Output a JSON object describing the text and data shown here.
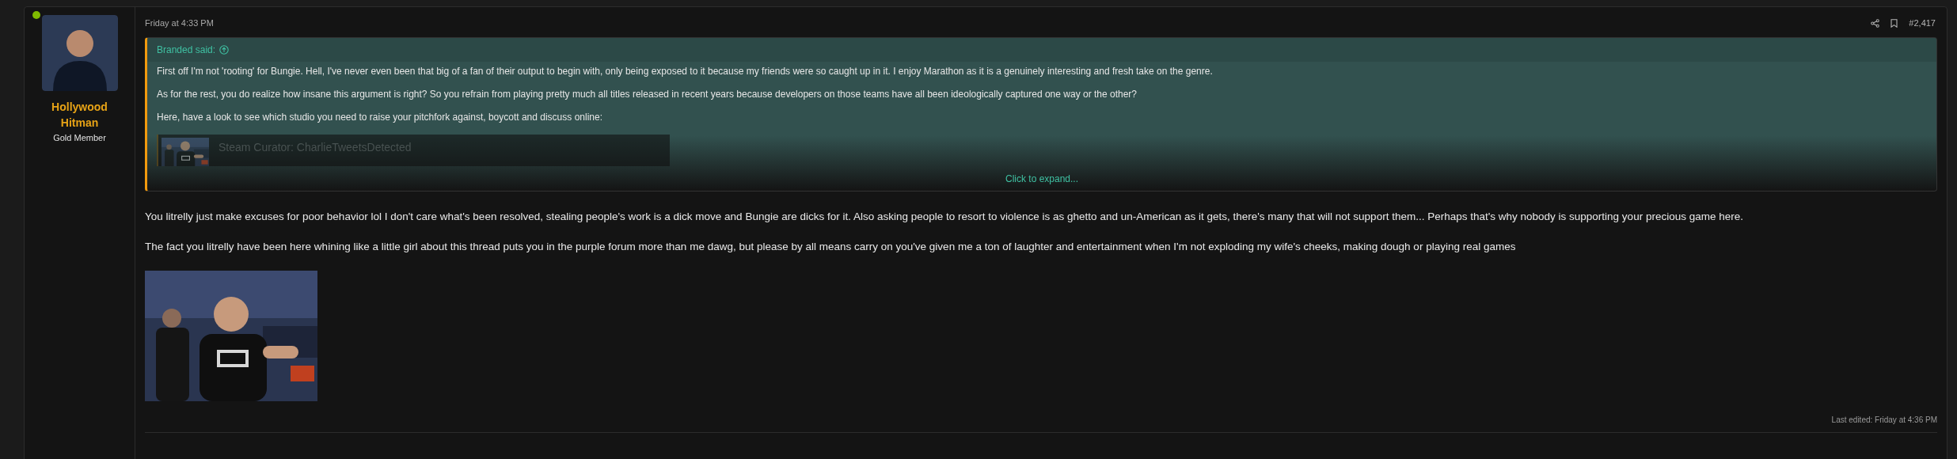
{
  "post": {
    "author": {
      "name": "Hollywood Hitman",
      "title": "Gold Member",
      "online": true
    },
    "date": "Friday at 4:33 PM",
    "post_number": "#2,417",
    "quote": {
      "attribution": "Branded said:",
      "paragraphs": [
        "First off I'm not 'rooting' for Bungie. Hell, I've never even been that big of a fan of their output to begin with, only being exposed to it because my friends were so caught up in it. I enjoy Marathon as it is a genuinely interesting and fresh take on the genre.",
        "As for the rest, you do realize how insane this argument is right? So you refrain from playing pretty much all titles released in recent years because developers on those teams have all been ideologically captured one way or the other?",
        "Here, have a look to see which studio you need to raise your pitchfork against, boycott and discuss online:"
      ],
      "embed_title": "Steam Curator: CharlieTweetsDetected",
      "expand_label": "Click to expand..."
    },
    "paragraphs": [
      "You litrelly just make excuses for poor behavior lol I don't care what's been resolved, stealing people's work is a dick move and Bungie are dicks for it. Also asking people to resort to violence is as ghetto and un-American as it gets, there's many that will not support them... Perhaps that's why nobody is supporting your precious game here.",
      "The fact you litrelly have been here whining like a little girl about this thread puts you in the purple forum more than me dawg, but please by all means carry on you've given me a ton of laughter and entertainment when I'm not exploding my wife's cheeks, making dough or playing real games"
    ],
    "attachment": {
      "kind": "picture"
    },
    "last_edited": "Last edited: Friday at 4:36 PM"
  }
}
